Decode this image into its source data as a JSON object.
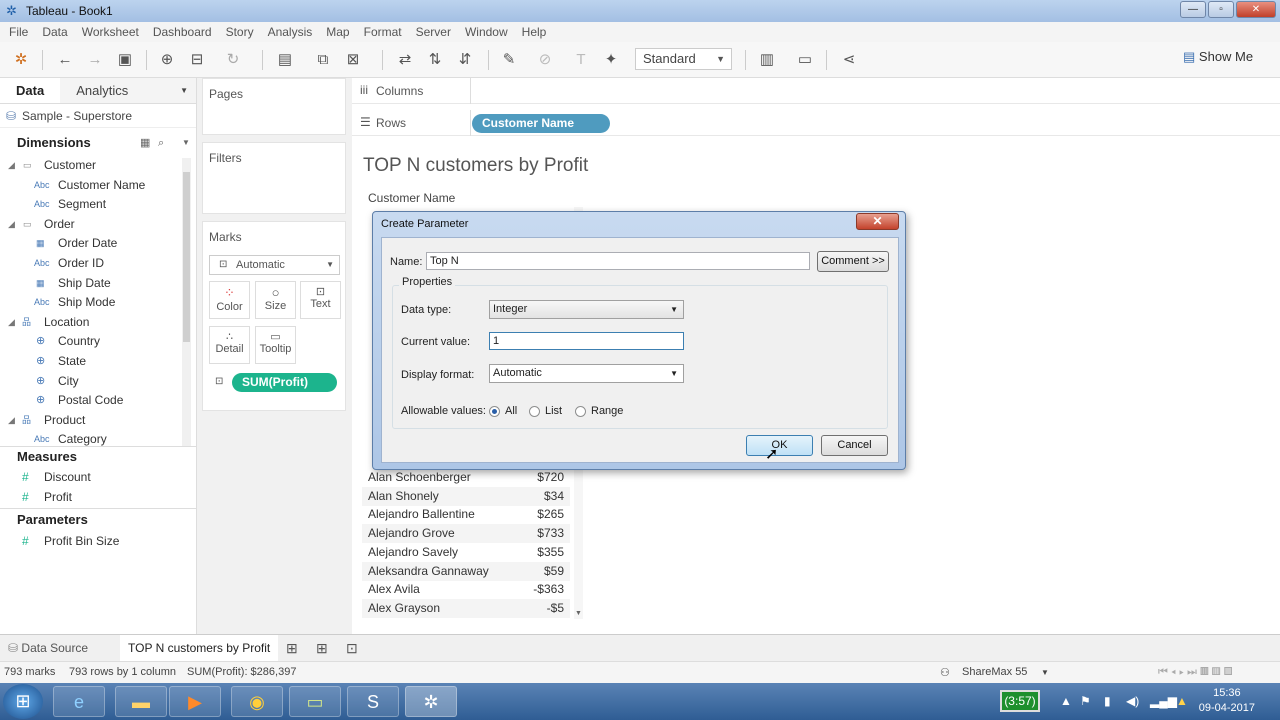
{
  "window": {
    "title": "Tableau - Book1"
  },
  "menu": [
    "File",
    "Data",
    "Worksheet",
    "Dashboard",
    "Story",
    "Analysis",
    "Map",
    "Format",
    "Server",
    "Window",
    "Help"
  ],
  "toolbar": {
    "fit_select": "Standard",
    "show_me": "Show Me"
  },
  "left_pane": {
    "tab_data": "Data",
    "tab_analytics": "Analytics",
    "datasource": "Sample - Superstore",
    "dimensions_title": "Dimensions",
    "dimensions": [
      {
        "label": "Customer",
        "kind": "folder"
      },
      {
        "label": "Customer Name",
        "kind": "abc"
      },
      {
        "label": "Segment",
        "kind": "abc"
      },
      {
        "label": "Order",
        "kind": "folder"
      },
      {
        "label": "Order Date",
        "kind": "date"
      },
      {
        "label": "Order ID",
        "kind": "abc"
      },
      {
        "label": "Ship Date",
        "kind": "date"
      },
      {
        "label": "Ship Mode",
        "kind": "abc"
      },
      {
        "label": "Location",
        "kind": "hier"
      },
      {
        "label": "Country",
        "kind": "geo"
      },
      {
        "label": "State",
        "kind": "geo"
      },
      {
        "label": "City",
        "kind": "geo"
      },
      {
        "label": "Postal Code",
        "kind": "geo"
      },
      {
        "label": "Product",
        "kind": "hier"
      },
      {
        "label": "Category",
        "kind": "abc"
      }
    ],
    "abc_icon": "Abc",
    "measures_title": "Measures",
    "measures": [
      "Discount",
      "Profit"
    ],
    "parameters_title": "Parameters",
    "parameters": [
      "Profit Bin Size"
    ]
  },
  "mid_pane": {
    "pages": "Pages",
    "filters": "Filters",
    "marks": "Marks",
    "mark_type": "Automatic",
    "mark_buttons": [
      "Color",
      "Size",
      "Text",
      "Detail",
      "Tooltip"
    ],
    "mark_pill": "SUM(Profit)"
  },
  "shelves": {
    "columns": "Columns",
    "rows": "Rows",
    "rows_pill": "Customer Name"
  },
  "sheet": {
    "title": "TOP N customers by Profit",
    "column_header": "Customer Name",
    "rows": [
      {
        "name": "Alan Schoenberger",
        "value": "$720"
      },
      {
        "name": "Alan Shonely",
        "value": "$34"
      },
      {
        "name": "Alejandro Ballentine",
        "value": "$265"
      },
      {
        "name": "Alejandro Grove",
        "value": "$733"
      },
      {
        "name": "Alejandro Savely",
        "value": "$355"
      },
      {
        "name": "Aleksandra Gannaway",
        "value": "$59"
      },
      {
        "name": "Alex Avila",
        "value": "-$363"
      },
      {
        "name": "Alex Grayson",
        "value": "-$5"
      }
    ]
  },
  "dialog": {
    "title": "Create Parameter",
    "close": "✕",
    "name_label": "Name:",
    "name_value": "Top N",
    "comment_button": "Comment >>",
    "properties": "Properties",
    "data_type_label": "Data type:",
    "data_type_value": "Integer",
    "current_value_label": "Current value:",
    "current_value": "1",
    "display_format_label": "Display format:",
    "display_format_value": "Automatic",
    "allowable_label": "Allowable values:",
    "allowable_options": [
      "All",
      "List",
      "Range"
    ],
    "allowable_selected": "All",
    "ok": "OK",
    "cancel": "Cancel"
  },
  "bottom_tabs": {
    "data_source": "Data Source",
    "sheet": "TOP N customers by Profit"
  },
  "status": {
    "marks": "793 marks",
    "rows": "793 rows by 1 column",
    "sum": "SUM(Profit): $286,397",
    "user": "ShareMax 55"
  },
  "taskbar": {
    "battery": "(3:57)",
    "time": "15:36",
    "date": "09-04-2017"
  },
  "colors": {
    "pill_blue": "#4f9bbf",
    "pill_green": "#1cb48d",
    "accent": "#2a5fa8"
  }
}
